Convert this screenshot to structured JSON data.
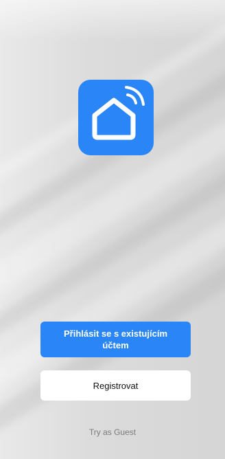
{
  "logo": {
    "icon": "smart-home-icon",
    "background_color": "#2a86f6",
    "glyph_color": "#ffffff"
  },
  "buttons": {
    "login_label": "Přihlásit se s existujícím účtem",
    "register_label": "Registrovat"
  },
  "guest_link": {
    "label": "Try as Guest"
  },
  "colors": {
    "accent": "#2a86f6",
    "secondary_button_bg": "#ffffff",
    "muted_text": "#7b7b7b"
  }
}
